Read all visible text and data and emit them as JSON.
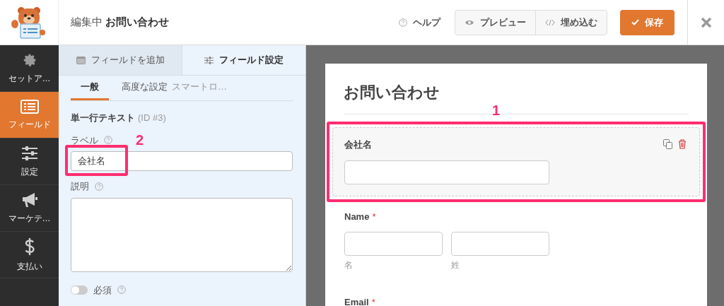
{
  "header": {
    "editing_prefix": "編集中",
    "form_name": "お問い合わせ",
    "help": "ヘルプ",
    "preview": "プレビュー",
    "embed": "埋め込む",
    "save": "保存"
  },
  "sidebar": {
    "items": [
      {
        "kind": "gear",
        "label": "セットア…",
        "selected": false
      },
      {
        "kind": "list",
        "label": "フィールド",
        "selected": true
      },
      {
        "kind": "sliders",
        "label": "設定",
        "selected": false
      },
      {
        "kind": "megaphone",
        "label": "マーケテ…",
        "selected": false
      },
      {
        "kind": "dollar",
        "label": "支払い",
        "selected": false
      }
    ]
  },
  "panel": {
    "tabs": [
      {
        "kind": "add",
        "label": "フィールドを追加",
        "selected": false
      },
      {
        "kind": "options",
        "label": "フィールド設定",
        "selected": true
      }
    ],
    "subtabs": [
      {
        "label": "一般",
        "selected": true
      },
      {
        "label": "高度な設定",
        "selected": false
      },
      {
        "label": "スマートロ…",
        "selected": false
      }
    ],
    "field_type": "単一行テキスト",
    "field_id": "(ID #3)",
    "label_caption": "ラベル",
    "label_value": "会社名",
    "description_caption": "説明",
    "required": {
      "label": "必須",
      "on": false
    }
  },
  "preview": {
    "title": "お問い合わせ",
    "required_mark": "*",
    "fields": [
      {
        "kind": "single",
        "label": "会社名",
        "required": false,
        "selected": true
      },
      {
        "kind": "name",
        "label": "Name",
        "required": true,
        "selected": false,
        "sublabels": [
          "名",
          "姓"
        ]
      },
      {
        "kind": "email",
        "label": "Email",
        "required": true,
        "selected": false
      }
    ]
  },
  "annotations": [
    {
      "label": "1"
    },
    {
      "label": "2"
    }
  ]
}
